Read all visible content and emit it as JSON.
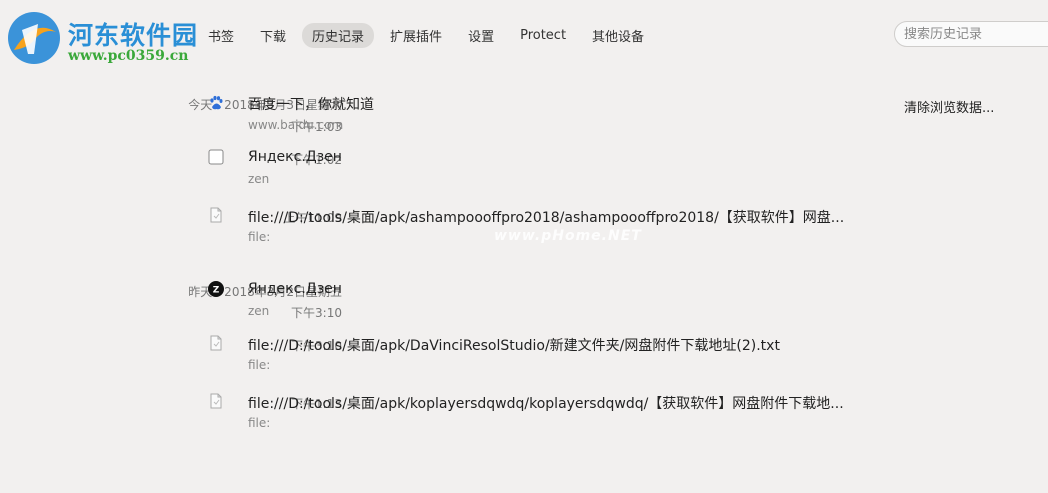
{
  "watermark": {
    "title": "河东软件园",
    "url": "www.pc0359.cn",
    "overlay": "www.pHome.NET"
  },
  "nav": {
    "tabs": [
      {
        "label": "书签"
      },
      {
        "label": "下载"
      },
      {
        "label": "历史记录"
      },
      {
        "label": "扩展插件"
      },
      {
        "label": "设置"
      },
      {
        "label": "Protect"
      },
      {
        "label": "其他设备"
      }
    ],
    "active_index": 2
  },
  "search": {
    "placeholder": "搜索历史记录"
  },
  "clear_label": "清除浏览数据...",
  "groups": [
    {
      "date": "今天 - 2018年3月3日星期六",
      "items": [
        {
          "time": "下午1:03",
          "title": "百度一下，你就知道",
          "url": "www.baidu.com",
          "icon": "baidu-paw-icon"
        },
        {
          "time": "下午1:02",
          "title": "Яндекс.Дзен",
          "url": "zen",
          "icon": "blank-page-icon"
        },
        {
          "time": "上午11:09",
          "title": "file:///D:/tools/桌面/apk/ashampoooffpro2018/ashampoooffpro2018/【获取软件】网盘...",
          "url": "file:",
          "icon": "file-icon"
        }
      ]
    },
    {
      "date": "昨天 - 2018年3月2日星期五",
      "items": [
        {
          "time": "下午3:10",
          "title": "Яндекс.Дзен",
          "url": "zen",
          "icon": "zen-logo-icon"
        },
        {
          "time": "下午3:10",
          "title": "file:///D:/tools/桌面/apk/DaVinciResolStudio/新建文件夹/网盘附件下载地址(2).txt",
          "url": "file:",
          "icon": "file-icon"
        },
        {
          "time": "下午1:13",
          "title": "file:///D:/tools/桌面/apk/koplayersdqwdq/koplayersdqwdq/【获取软件】网盘附件下载地...",
          "url": "file:",
          "icon": "file-icon"
        }
      ]
    }
  ],
  "colors": {
    "background": "#f2f0ef",
    "active_tab": "#dcdad8",
    "logo_blue": "#2a8fd6",
    "logo_green": "#3aa83a",
    "baidu_blue": "#2f6fd8"
  }
}
